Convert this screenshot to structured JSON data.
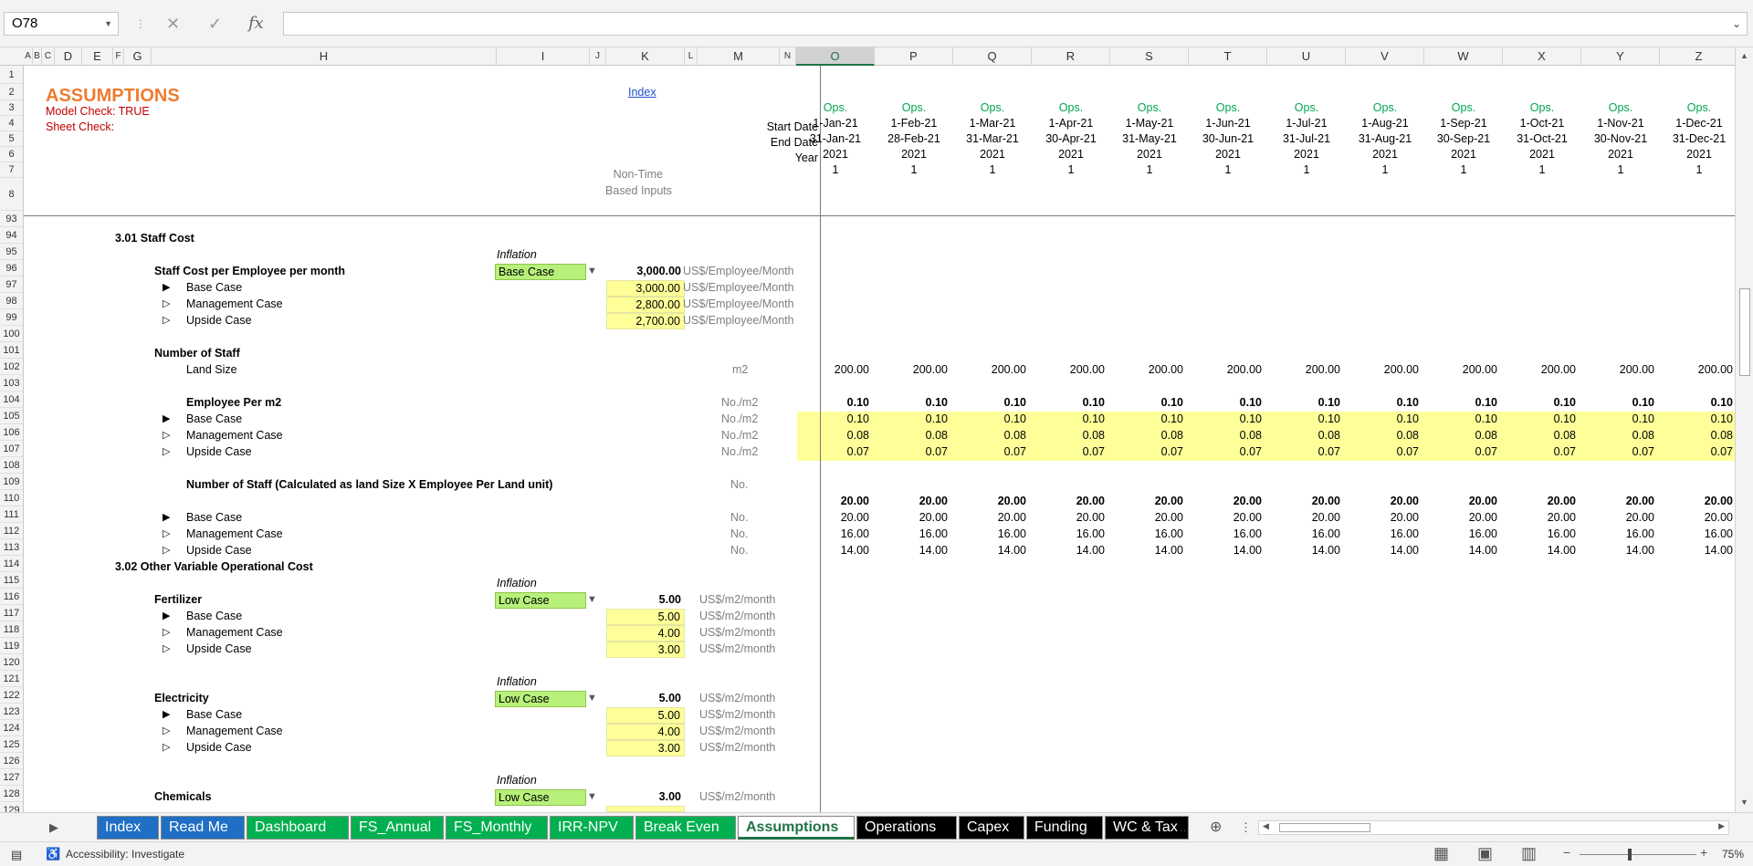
{
  "formula_bar": {
    "name_box": "O78",
    "cancel_icon": "✕",
    "enter_icon": "✓",
    "fx_label": "fx",
    "formula": ""
  },
  "columns": [
    "A",
    "B",
    "C",
    "D",
    "E",
    "F",
    "G",
    "H",
    "I",
    "J",
    "K",
    "L",
    "M",
    "N",
    "O",
    "P",
    "Q",
    "R",
    "S",
    "T",
    "U",
    "V",
    "W",
    "X",
    "Y",
    "Z"
  ],
  "selected_column": "O",
  "rows": [
    "1",
    "2",
    "3",
    "4",
    "5",
    "6",
    "7",
    "8",
    "93",
    "94",
    "95",
    "96",
    "97",
    "98",
    "99",
    "100",
    "101",
    "102",
    "103",
    "104",
    "105",
    "106",
    "107",
    "108",
    "109",
    "110",
    "111",
    "112",
    "113",
    "114",
    "115",
    "116",
    "117",
    "118",
    "119",
    "120",
    "121",
    "122",
    "123",
    "124",
    "125",
    "126",
    "127",
    "128",
    "129"
  ],
  "sheet": {
    "title": "ASSUMPTIONS",
    "model_check": "Model Check: TRUE",
    "sheet_check": "Sheet Check:",
    "index_link": "Index",
    "non_time_1": "Non-Time",
    "non_time_2": "Based Inputs",
    "labels": {
      "start_date": "Start Date",
      "end_date": "End Date",
      "year": "Year"
    },
    "timeline": {
      "ops": [
        "Ops.",
        "Ops.",
        "Ops.",
        "Ops.",
        "Ops.",
        "Ops.",
        "Ops.",
        "Ops.",
        "Ops.",
        "Ops.",
        "Ops.",
        "Ops."
      ],
      "start": [
        "1-Jan-21",
        "1-Feb-21",
        "1-Mar-21",
        "1-Apr-21",
        "1-May-21",
        "1-Jun-21",
        "1-Jul-21",
        "1-Aug-21",
        "1-Sep-21",
        "1-Oct-21",
        "1-Nov-21",
        "1-Dec-21"
      ],
      "end": [
        "31-Jan-21",
        "28-Feb-21",
        "31-Mar-21",
        "30-Apr-21",
        "31-May-21",
        "30-Jun-21",
        "31-Jul-21",
        "31-Aug-21",
        "30-Sep-21",
        "31-Oct-21",
        "30-Nov-21",
        "31-Dec-21"
      ],
      "year": [
        "2021",
        "2021",
        "2021",
        "2021",
        "2021",
        "2021",
        "2021",
        "2021",
        "2021",
        "2021",
        "2021",
        "2021"
      ],
      "flag": [
        "1",
        "1",
        "1",
        "1",
        "1",
        "1",
        "1",
        "1",
        "1",
        "1",
        "1",
        "1"
      ]
    },
    "staff": {
      "section": "3.01  Staff Cost",
      "inflation": "Inflation",
      "cost_label": "Staff Cost per Employee per month",
      "case_select": "Base Case",
      "cost_value": "3,000.00",
      "unit": "US$/Employee/Month",
      "cases": [
        {
          "marker": "▶",
          "name": "Base Case",
          "value": "3,000.00",
          "unit": "US$/Employee/Month"
        },
        {
          "marker": "▷",
          "name": "Management Case",
          "value": "2,800.00",
          "unit": "US$/Employee/Month"
        },
        {
          "marker": "▷",
          "name": "Upside Case",
          "value": "2,700.00",
          "unit": "US$/Employee/Month"
        }
      ],
      "number_of_staff": "Number of Staff",
      "land_size_label": "Land Size",
      "land_size_unit": "m2",
      "land_size_values": [
        "200.00",
        "200.00",
        "200.00",
        "200.00",
        "200.00",
        "200.00",
        "200.00",
        "200.00",
        "200.00",
        "200.00",
        "200.00",
        "200.00"
      ],
      "emp_per_m2_label": "Employee Per m2",
      "emp_unit": "No./m2",
      "emp_total": [
        "0.10",
        "0.10",
        "0.10",
        "0.10",
        "0.10",
        "0.10",
        "0.10",
        "0.10",
        "0.10",
        "0.10",
        "0.10",
        "0.10"
      ],
      "emp_cases": [
        {
          "marker": "▶",
          "name": "Base Case",
          "unit": "No./m2",
          "values": [
            "0.10",
            "0.10",
            "0.10",
            "0.10",
            "0.10",
            "0.10",
            "0.10",
            "0.10",
            "0.10",
            "0.10",
            "0.10",
            "0.10"
          ]
        },
        {
          "marker": "▷",
          "name": "Management Case",
          "unit": "No./m2",
          "values": [
            "0.08",
            "0.08",
            "0.08",
            "0.08",
            "0.08",
            "0.08",
            "0.08",
            "0.08",
            "0.08",
            "0.08",
            "0.08",
            "0.08"
          ]
        },
        {
          "marker": "▷",
          "name": "Upside Case",
          "unit": "No./m2",
          "values": [
            "0.07",
            "0.07",
            "0.07",
            "0.07",
            "0.07",
            "0.07",
            "0.07",
            "0.07",
            "0.07",
            "0.07",
            "0.07",
            "0.07"
          ]
        }
      ],
      "num_staff_label": "Number of Staff (Calculated as land Size X Employee Per Land unit)",
      "num_unit": "No.",
      "num_total": [
        "20.00",
        "20.00",
        "20.00",
        "20.00",
        "20.00",
        "20.00",
        "20.00",
        "20.00",
        "20.00",
        "20.00",
        "20.00",
        "20.00"
      ],
      "num_cases": [
        {
          "marker": "▶",
          "name": "Base Case",
          "unit": "No.",
          "values": [
            "20.00",
            "20.00",
            "20.00",
            "20.00",
            "20.00",
            "20.00",
            "20.00",
            "20.00",
            "20.00",
            "20.00",
            "20.00",
            "20.00"
          ]
        },
        {
          "marker": "▷",
          "name": "Management Case",
          "unit": "No.",
          "values": [
            "16.00",
            "16.00",
            "16.00",
            "16.00",
            "16.00",
            "16.00",
            "16.00",
            "16.00",
            "16.00",
            "16.00",
            "16.00",
            "16.00"
          ]
        },
        {
          "marker": "▷",
          "name": "Upside Case",
          "unit": "No.",
          "values": [
            "14.00",
            "14.00",
            "14.00",
            "14.00",
            "14.00",
            "14.00",
            "14.00",
            "14.00",
            "14.00",
            "14.00",
            "14.00",
            "14.00"
          ]
        }
      ]
    },
    "other": {
      "section": "3.02  Other Variable Operational Cost",
      "items": [
        {
          "inflation": "Inflation",
          "name": "Fertilizer",
          "select": "Low Case",
          "value": "5.00",
          "unit": "US$/m2/month",
          "cases": [
            {
              "marker": "▶",
              "name": "Base Case",
              "value": "5.00",
              "unit": "US$/m2/month"
            },
            {
              "marker": "▷",
              "name": "Management Case",
              "value": "4.00",
              "unit": "US$/m2/month"
            },
            {
              "marker": "▷",
              "name": "Upside Case",
              "value": "3.00",
              "unit": "US$/m2/month"
            }
          ]
        },
        {
          "inflation": "Inflation",
          "name": "Electricity",
          "select": "Low Case",
          "value": "5.00",
          "unit": "US$/m2/month",
          "cases": [
            {
              "marker": "▶",
              "name": "Base Case",
              "value": "5.00",
              "unit": "US$/m2/month"
            },
            {
              "marker": "▷",
              "name": "Management Case",
              "value": "4.00",
              "unit": "US$/m2/month"
            },
            {
              "marker": "▷",
              "name": "Upside Case",
              "value": "3.00",
              "unit": "US$/m2/month"
            }
          ]
        },
        {
          "inflation": "Inflation",
          "name": "Chemicals",
          "select": "Low Case",
          "value": "3.00",
          "unit": "US$/m2/month",
          "cases": []
        }
      ]
    }
  },
  "tabs": [
    {
      "label": "Index",
      "color": "#1f6fc5"
    },
    {
      "label": "Read Me",
      "color": "#1f6fc5"
    },
    {
      "label": "Dashboard",
      "color": "#00b050"
    },
    {
      "label": "FS_Annual",
      "color": "#00b050"
    },
    {
      "label": "FS_Monthly",
      "color": "#00b050"
    },
    {
      "label": "IRR-NPV",
      "color": "#00b050"
    },
    {
      "label": "Break Even",
      "color": "#00b050"
    },
    {
      "label": "Assumptions",
      "color": "#ffffff"
    },
    {
      "label": "Operations",
      "color": "#000000"
    },
    {
      "label": "Capex",
      "color": "#000000"
    },
    {
      "label": "Funding",
      "color": "#000000"
    },
    {
      "label": "WC & Tax",
      "color": "#000000"
    }
  ],
  "active_tab": "Assumptions",
  "tab_more": "...",
  "status": {
    "accessibility": "Accessibility: Investigate",
    "zoom": "75%",
    "zoom_level": 0.75
  }
}
